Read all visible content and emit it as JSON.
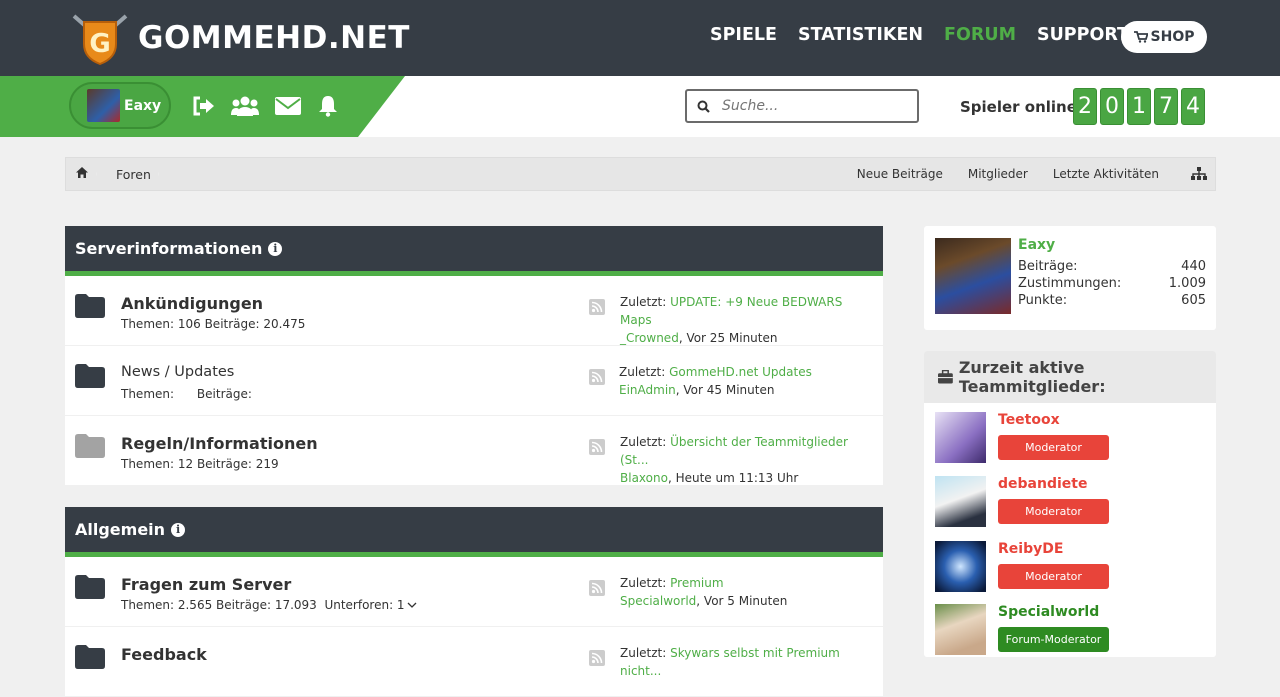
{
  "header": {
    "brand": "GOMMEHD.NET",
    "nav": [
      "SPIELE",
      "STATISTIKEN",
      "FORUM",
      "SUPPORT"
    ],
    "active_nav": "FORUM",
    "shop_label": "SHOP"
  },
  "subbar": {
    "username": "Eaxy",
    "search_placeholder": "Suche...",
    "online_label": "Spieler online:",
    "online_digits": [
      "2",
      "0",
      "1",
      "7",
      "4"
    ]
  },
  "breadcrumb": {
    "current": "Foren",
    "links": [
      "Neue Beiträge",
      "Mitglieder",
      "Letzte Aktivitäten"
    ]
  },
  "categories": [
    {
      "title": "Serverinformationen",
      "forums": [
        {
          "title": "Ankündigungen",
          "stats": "Themen: 106 Beiträge: 20.475",
          "last_prefix": "Zuletzt:",
          "last_title": "UPDATE: +9 Neue BEDWARS Maps",
          "last_user": "_Crowned",
          "last_time": ", Vor 25 Minuten"
        },
        {
          "title": "News / Updates",
          "stats": "Themen:      Beiträge:",
          "last_prefix": "Zuletzt:",
          "last_title": "GommeHD.net Updates",
          "last_user": "EinAdmin",
          "last_time": ", Vor 45 Minuten"
        },
        {
          "title": "Regeln/Informationen",
          "stats": "Themen: 12 Beiträge: 219",
          "last_prefix": "Zuletzt:",
          "last_title": "Übersicht der Teammitglieder (St...",
          "last_user": "Blaxono",
          "last_time": ", Heute um 11:13 Uhr"
        }
      ]
    },
    {
      "title": "Allgemein",
      "forums": [
        {
          "title": "Fragen zum Server",
          "stats": "Themen: 2.565 Beiträge: 17.093  Unterforen: 1",
          "last_prefix": "Zuletzt:",
          "last_title": "Premium",
          "last_user": "Specialworld",
          "last_time": ", Vor 5 Minuten"
        },
        {
          "title": "Feedback",
          "stats": "",
          "last_prefix": "Zuletzt:",
          "last_title": "Skywars selbst mit Premium nicht...",
          "last_user": "",
          "last_time": ""
        }
      ]
    }
  ],
  "sidebar": {
    "user": {
      "name": "Eaxy",
      "stats": [
        {
          "label": "Beiträge:",
          "value": "440"
        },
        {
          "label": "Zustimmungen:",
          "value": "1.009"
        },
        {
          "label": "Punkte:",
          "value": "605"
        }
      ]
    },
    "team_title": "Zurzeit aktive Teammitglieder:",
    "team": [
      {
        "name": "Teetoox",
        "role": "Moderator",
        "color": "#e8443a"
      },
      {
        "name": "debandiete",
        "role": "Moderator",
        "color": "#e8443a"
      },
      {
        "name": "ReibyDE",
        "role": "Moderator",
        "color": "#e8443a"
      },
      {
        "name": "Specialworld",
        "role": "Forum-Moderator",
        "color": "#2e8b22"
      }
    ]
  },
  "colors": {
    "accent": "#4fae47",
    "dark": "#363d45",
    "moderator": "#e8443a"
  }
}
